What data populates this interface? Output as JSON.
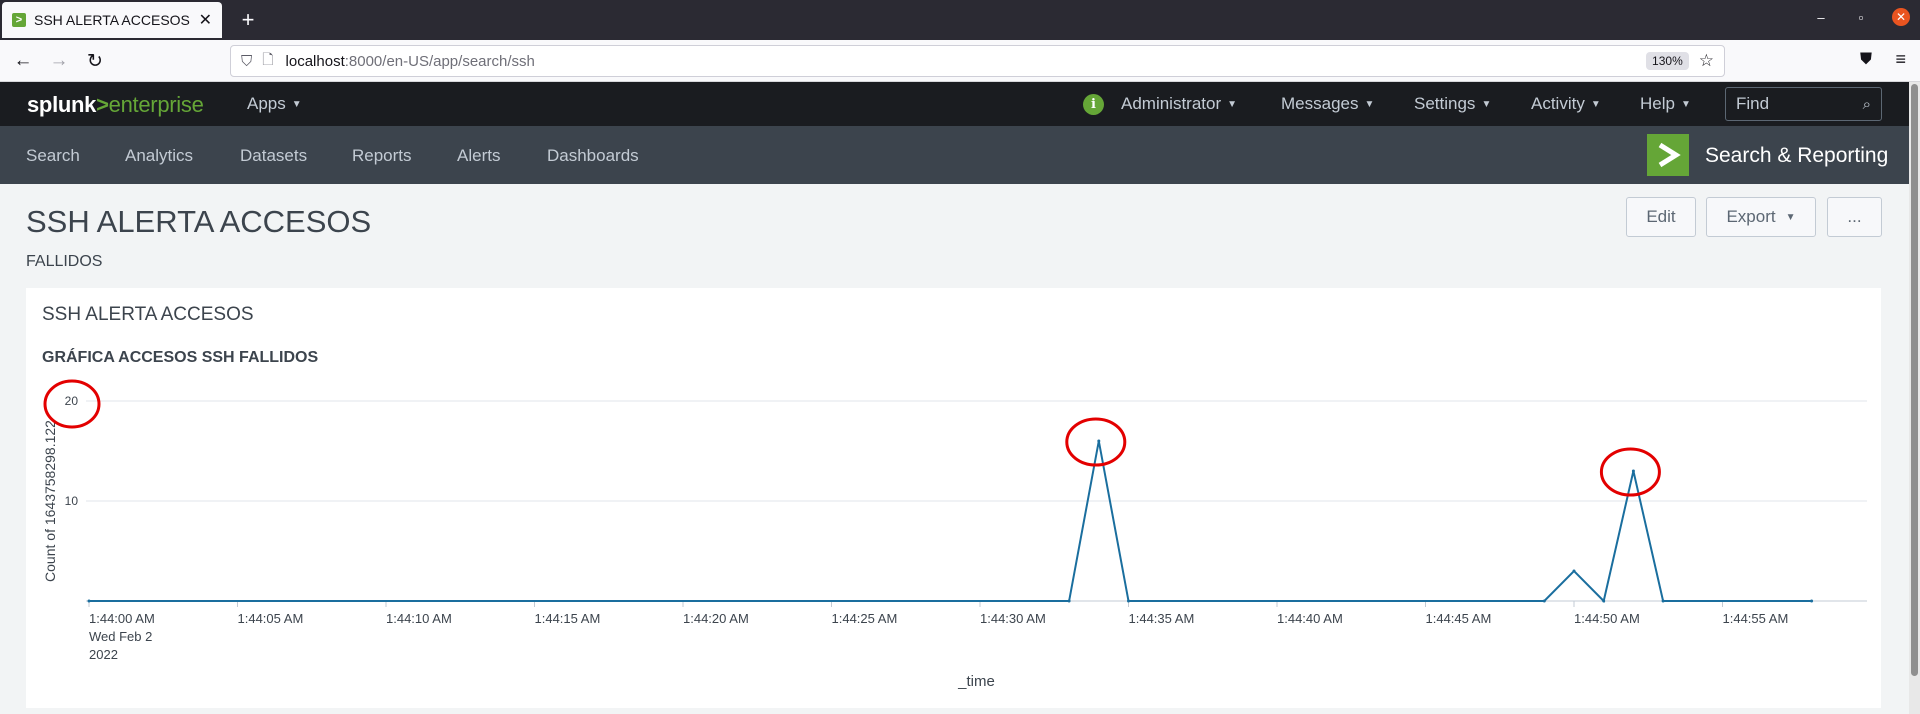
{
  "browser": {
    "tab_title": "SSH ALERTA ACCESOS | S",
    "url_host": "localhost",
    "url_path": ":8000/en-US/app/search/ssh",
    "zoom": "130%"
  },
  "header": {
    "logo_splunk": "splunk",
    "logo_gt": ">",
    "logo_enterprise": "enterprise",
    "apps_label": "Apps",
    "menu": [
      "Administrator",
      "Messages",
      "Settings",
      "Activity",
      "Help"
    ],
    "find_placeholder": "Find"
  },
  "appbar": {
    "nav": [
      "Search",
      "Analytics",
      "Datasets",
      "Reports",
      "Alerts",
      "Dashboards"
    ],
    "app_name": "Search & Reporting"
  },
  "dashboard": {
    "title": "SSH ALERTA ACCESOS",
    "description": "FALLIDOS",
    "edit_label": "Edit",
    "export_label": "Export",
    "more_label": "..."
  },
  "panel": {
    "title": "SSH ALERTA ACCESOS",
    "chart_title": "GRÁFICA ACCESOS SSH FALLIDOS"
  },
  "colors": {
    "series": "#1a6e9e",
    "annotation": "#e30000",
    "accent": "#65a637"
  },
  "chart_data": {
    "type": "line",
    "title": "GRÁFICA ACCESOS SSH FALLIDOS",
    "xlabel": "_time",
    "ylabel": "Count of 1643758298.122",
    "ylim": [
      0,
      20
    ],
    "y_ticks": [
      "10",
      "20"
    ],
    "x_tick_labels": [
      "1:44:00 AM",
      "1:44:05 AM",
      "1:44:10 AM",
      "1:44:15 AM",
      "1:44:20 AM",
      "1:44:25 AM",
      "1:44:30 AM",
      "1:44:35 AM",
      "1:44:40 AM",
      "1:44:45 AM",
      "1:44:50 AM",
      "1:44:55 AM"
    ],
    "x_first_sublabel": [
      "Wed Feb 2",
      "2022"
    ],
    "x": [
      "1:44:00 AM",
      "1:44:33 AM",
      "1:44:34 AM",
      "1:44:35 AM",
      "1:44:49 AM",
      "1:44:50 AM",
      "1:44:51 AM",
      "1:44:52 AM",
      "1:44:53 AM",
      "1:44:58 AM"
    ],
    "values": [
      0,
      0,
      16,
      0,
      0,
      3,
      0,
      13,
      0,
      0
    ],
    "annotations": [
      "y-axis 20 tick",
      "peak 1:44:34 AM",
      "peak 1:44:52 AM"
    ],
    "grid": true,
    "legend": "none"
  }
}
